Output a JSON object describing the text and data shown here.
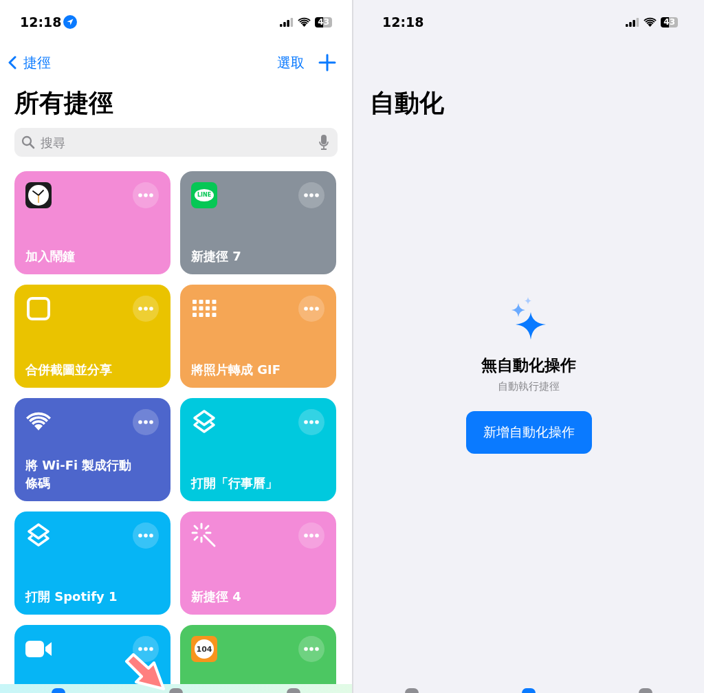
{
  "left_screen": {
    "status_bar": {
      "time": "12:18",
      "location": true,
      "battery": "43"
    },
    "nav": {
      "back": "捷徑",
      "select": "選取"
    },
    "title": "所有捷徑",
    "search": {
      "placeholder": "搜尋"
    },
    "shortcuts": [
      {
        "title": "加入鬧鐘",
        "color": "#f38bd6",
        "kind": "clock"
      },
      {
        "title": "新捷徑 7",
        "color": "#88919b",
        "kind": "line",
        "icon_text": "LINE"
      },
      {
        "title": "合併截圖並分享",
        "color": "#eac300",
        "kind": "square"
      },
      {
        "title": "將照片轉成 GIF",
        "color": "#f5a655",
        "kind": "grid"
      },
      {
        "title": "將 Wi-Fi 製成行動條碼",
        "color": "#4d66cc",
        "kind": "wifi"
      },
      {
        "title": "打開「行事曆」",
        "color": "#00c9de",
        "kind": "layers"
      },
      {
        "title": "打開 Spotify 1",
        "color": "#06b5f5",
        "kind": "layers"
      },
      {
        "title": "新捷徑 4",
        "color": "#f38bd8",
        "kind": "wand"
      },
      {
        "color": "#06b5f5",
        "kind": "video"
      },
      {
        "color": "#4cc762",
        "kind": "logo104",
        "icon_text": "104"
      }
    ],
    "tab_bar": [
      {
        "selected": true
      },
      {
        "selected": false
      },
      {
        "selected": false
      }
    ],
    "pointer_arrow": true
  },
  "right_screen": {
    "status_bar": {
      "time": "12:18",
      "location": false,
      "battery": "43"
    },
    "title": "自動化",
    "empty_state": {
      "heading": "無自動化操作",
      "subtitle": "自動執行捷徑",
      "button": "新增自動化操作"
    },
    "tab_bar": [
      {
        "selected": false
      },
      {
        "selected": true
      },
      {
        "selected": false
      }
    ]
  }
}
